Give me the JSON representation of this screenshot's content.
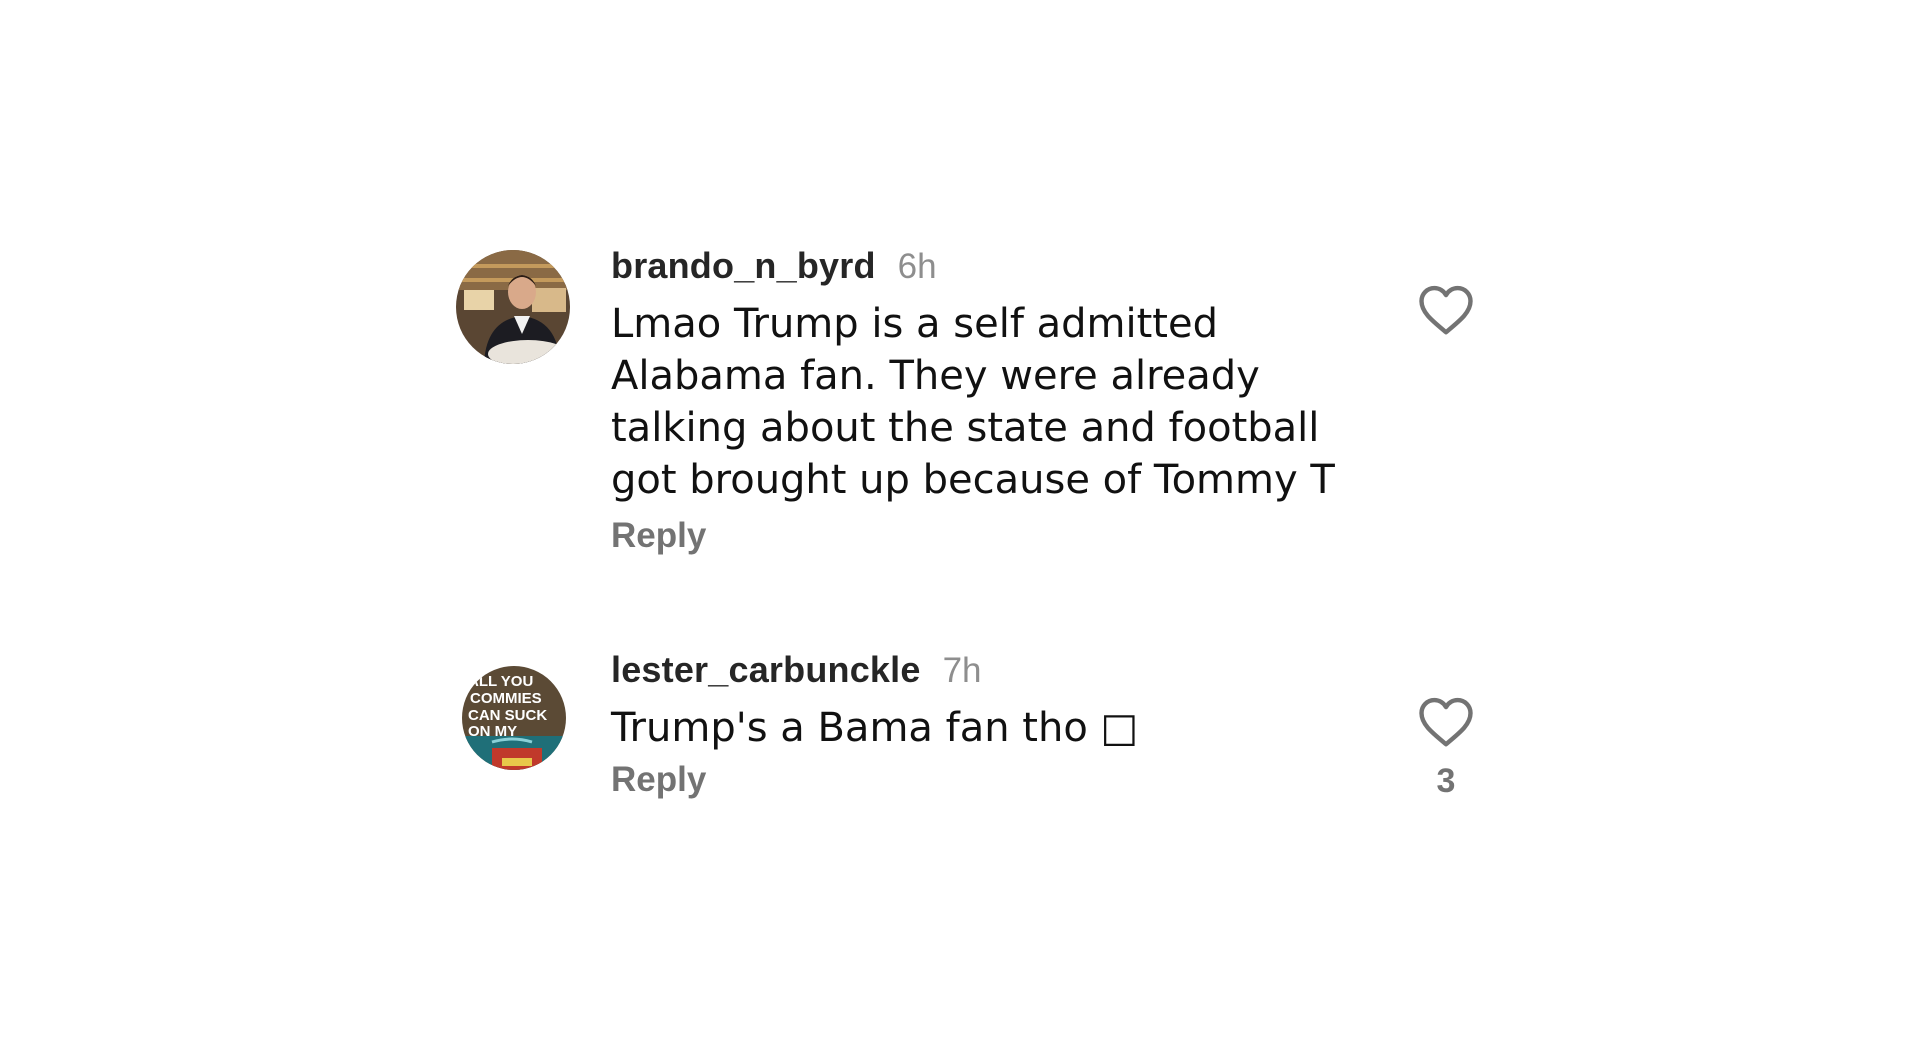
{
  "comments": [
    {
      "username": "brando_n_byrd",
      "timestamp": "6h",
      "text": "Lmao Trump is a self admitted\nAlabama fan. They were already\ntalking about the state and football\ngot brought up because of Tommy T",
      "reply_label": "Reply",
      "like_icon": "heart-outline-icon",
      "like_count": ""
    },
    {
      "username": "lester_carbunckle",
      "timestamp": "7h",
      "text": "Trump's a Bama fan tho □",
      "reply_label": "Reply",
      "like_icon": "heart-outline-icon",
      "like_count": "3",
      "avatar_text": [
        "ALL YOU",
        "COMMIES",
        "CAN SUCK",
        "ON MY"
      ]
    }
  ],
  "colors": {
    "username": "#262626",
    "timestamp": "#8e8e8e",
    "reply": "#737373",
    "icon": "#737373"
  }
}
